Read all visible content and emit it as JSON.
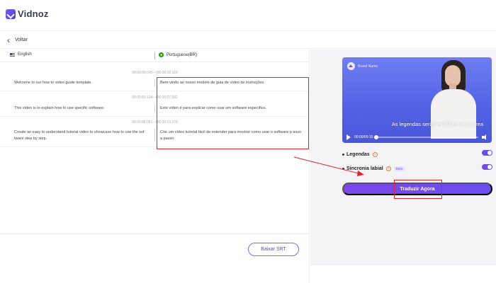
{
  "app": {
    "brand": "Vidnoz"
  },
  "nav": {
    "back_label": "Voltar"
  },
  "languages": {
    "source": "English",
    "target": "Portuguese(BR)"
  },
  "segments": [
    {
      "time": "00:00:00,645-->00:00:02,110",
      "source": "Welcome to our how to video guide template.",
      "target": "Bem-vindo ao nosso modelo de guia de vídeo de instruções."
    },
    {
      "time": "00:00:03,104-->00:00:07,002",
      "source": "This video is to explain how to use specific software.",
      "target": "Este vídeo é para explicar como usar um software específico."
    },
    {
      "time": "00:00:08,051-->00:00:13,270",
      "source": "Create an easy to understand tutorial video to showcase how to use the sof tware step by step.",
      "target": "Crie um vídeo tutorial fácil de entender para mostrar como usar o software p asso a passo."
    }
  ],
  "footer": {
    "download_srt": "Baixar SRT"
  },
  "video": {
    "brand_name": "Brand Name",
    "caption": "As legendas serão exibidas nesta área",
    "time": "00:00/00:15",
    "progress": 0.0
  },
  "options": {
    "subtitles_label": "Legendas",
    "subtitles_on": true,
    "lipsync_label": "Sincronia labial",
    "lipsync_badge": "Beta",
    "lipsync_on": true,
    "info_glyph": "i"
  },
  "actions": {
    "translate": "Traduzir Agora"
  },
  "colors": {
    "accent": "#6d4dea",
    "highlight": "#e0262d"
  },
  "icons": {
    "back": "chevron-left-icon",
    "play": "play-icon",
    "volume": "volume-icon"
  }
}
